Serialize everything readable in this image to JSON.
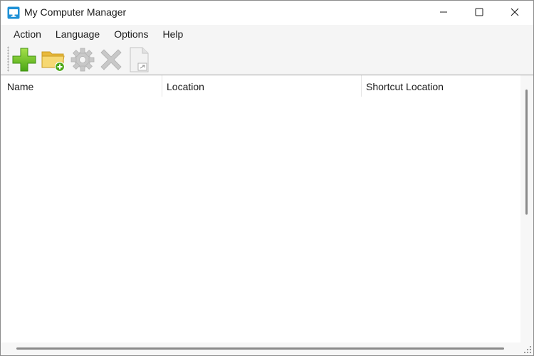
{
  "window": {
    "title": "My Computer Manager",
    "icon": "monitor-icon",
    "controls": [
      "minimize-icon",
      "maximize-icon",
      "close-icon"
    ]
  },
  "menu": {
    "items": [
      "Action",
      "Language",
      "Options",
      "Help"
    ]
  },
  "toolbar": {
    "buttons": [
      {
        "icon": "add-icon",
        "enabled": true
      },
      {
        "icon": "add-folder-icon",
        "enabled": true
      },
      {
        "icon": "gear-icon",
        "enabled": false
      },
      {
        "icon": "delete-icon",
        "enabled": false
      },
      {
        "icon": "shortcut-file-icon",
        "enabled": false
      }
    ]
  },
  "list": {
    "columns": [
      "Name",
      "Location",
      "Shortcut Location"
    ],
    "rows": []
  },
  "colors": {
    "accent": "#1e90d6",
    "add_green": "#6cc21a",
    "folder_yellow": "#f2c94c",
    "disabled_gray": "#c8c8c8"
  }
}
